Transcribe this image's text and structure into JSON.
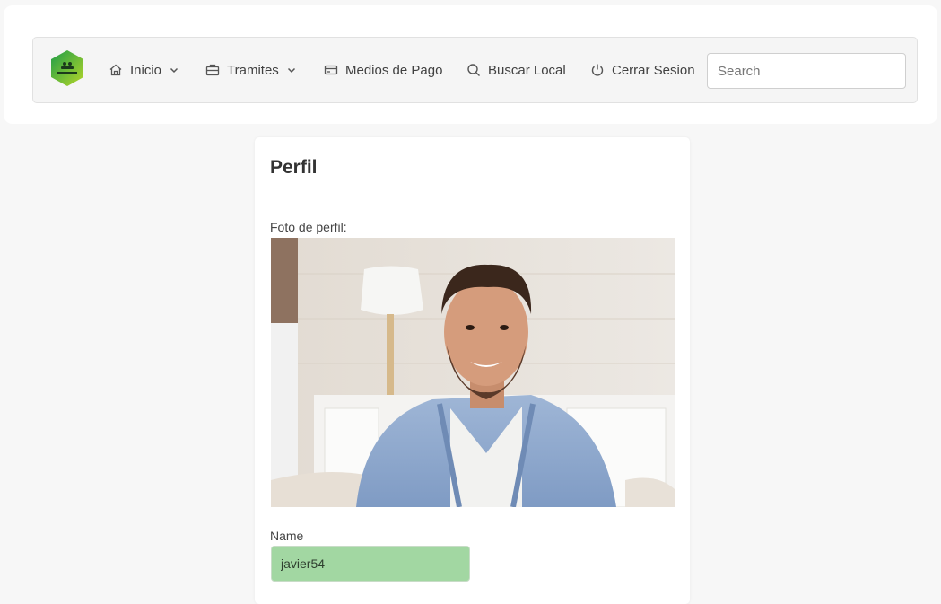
{
  "nav": {
    "logo_alt": "app-logo",
    "items": [
      {
        "label": "Inicio",
        "icon": "home-icon",
        "dropdown": true
      },
      {
        "label": "Tramites",
        "icon": "briefcase-icon",
        "dropdown": true
      },
      {
        "label": "Medios de Pago",
        "icon": "credit-card-icon",
        "dropdown": false
      },
      {
        "label": "Buscar Local",
        "icon": "search-icon",
        "dropdown": false
      },
      {
        "label": "Cerrar Sesion",
        "icon": "power-icon",
        "dropdown": false
      }
    ],
    "search": {
      "placeholder": "Search",
      "value": ""
    }
  },
  "profile": {
    "title": "Perfil",
    "photo_label": "Foto de perfil:",
    "name_label": "Name",
    "name_value": "javier54"
  },
  "colors": {
    "page_bg": "#f7f7f7",
    "name_field_bg": "#a2d7a2",
    "logo_green": "#2bb34a",
    "logo_lime": "#a6d22c"
  }
}
